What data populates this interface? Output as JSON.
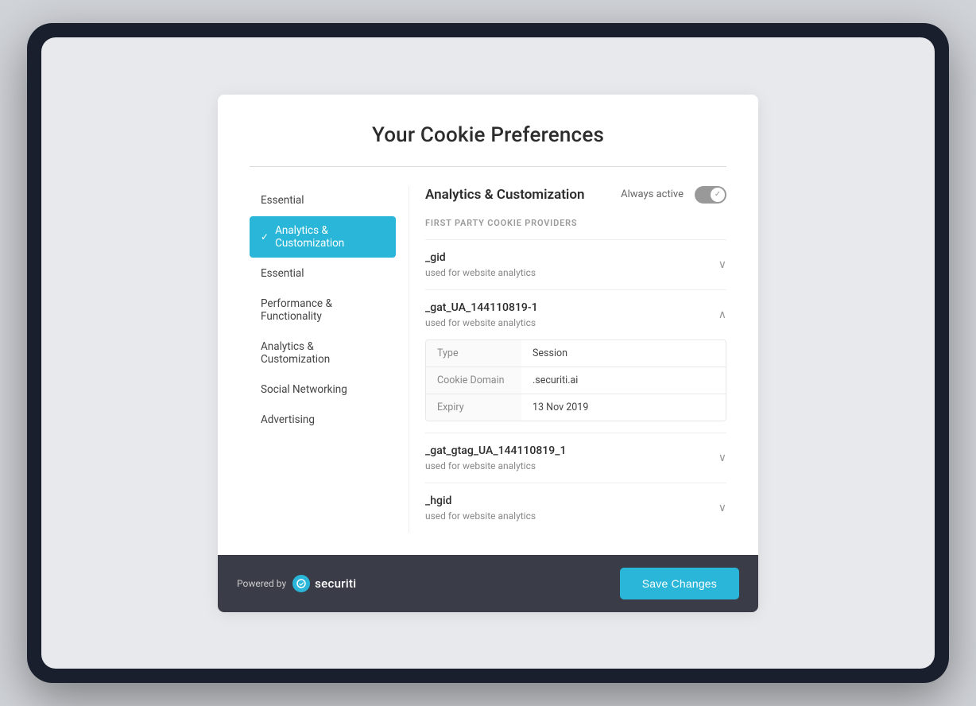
{
  "page": {
    "title": "Your Cookie Preferences"
  },
  "sidebar": {
    "items": [
      {
        "id": "essential-top",
        "label": "Essential",
        "active": false
      },
      {
        "id": "analytics-customization",
        "label": "Analytics & Customization",
        "active": true
      },
      {
        "id": "essential",
        "label": "Essential",
        "active": false
      },
      {
        "id": "performance-functionality",
        "label": "Performance & Functionality",
        "active": false
      },
      {
        "id": "analytics-customization-2",
        "label": "Analytics & Customization",
        "active": false
      },
      {
        "id": "social-networking",
        "label": "Social Networking",
        "active": false
      },
      {
        "id": "advertising",
        "label": "Advertising",
        "active": false
      }
    ]
  },
  "panel": {
    "title": "Analytics & Customization",
    "always_active_label": "Always active",
    "section_label": "FIRST PARTY COOKIE PROVIDERS",
    "cookies": [
      {
        "id": "gid",
        "name": "_gid",
        "description": "used for website analytics",
        "expanded": false
      },
      {
        "id": "gat_ua",
        "name": "_gat_UA_144110819-1",
        "description": "used for website analytics",
        "expanded": true,
        "details": [
          {
            "label": "Type",
            "value": "Session"
          },
          {
            "label": "Cookie Domain",
            "value": ".securiti.ai"
          },
          {
            "label": "Expiry",
            "value": "13 Nov 2019"
          }
        ]
      },
      {
        "id": "gat_gtag",
        "name": "_gat_gtag_UA_144110819_1",
        "description": "used for website analytics",
        "expanded": false
      },
      {
        "id": "hgid",
        "name": "_hgid",
        "description": "used for website analytics",
        "expanded": false
      }
    ]
  },
  "footer": {
    "powered_by_label": "Powered by",
    "brand_name": "securiti",
    "save_button_label": "Save Changes"
  }
}
